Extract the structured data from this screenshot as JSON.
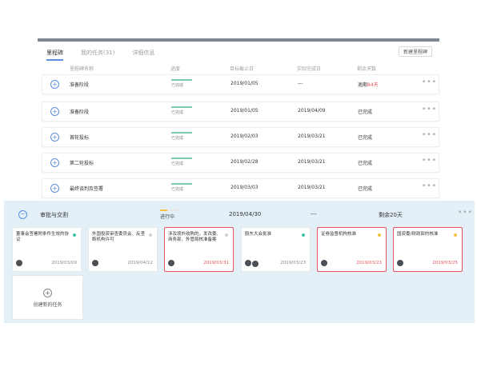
{
  "tabs": [
    {
      "label": "里程碑"
    },
    {
      "label": "我的任务(31)"
    },
    {
      "label": "详细信息"
    }
  ],
  "new_milestone_label": "新建里程碑",
  "header": {
    "name": "里程碑名称",
    "progress": "进度",
    "target": "目标截止日",
    "actual": "实际完成日",
    "remain": "剩余天数"
  },
  "rows": [
    {
      "name": "准备阶段",
      "progress": "已完成",
      "progress_fraction": 1,
      "target": "2019/01/05",
      "actual": "---",
      "remain_prefix": "逾期",
      "remain_late": "84天"
    },
    {
      "name": "准备阶段",
      "progress": "已完成",
      "progress_fraction": 1,
      "target": "2019/01/05",
      "actual": "2019/04/09",
      "remain_prefix": "已完成",
      "remain_late": ""
    },
    {
      "name": "首轮投标",
      "progress": "已完成",
      "progress_fraction": 1,
      "target": "2019/02/03",
      "actual": "2019/03/21",
      "remain_prefix": "已完成",
      "remain_late": ""
    },
    {
      "name": "第二轮投标",
      "progress": "已完成",
      "progress_fraction": 1,
      "target": "2019/02/28",
      "actual": "2019/03/21",
      "remain_prefix": "已完成",
      "remain_late": ""
    },
    {
      "name": "最终谈判及签署",
      "progress": "已完成",
      "progress_fraction": 1,
      "target": "2019/03/03",
      "actual": "2019/03/21",
      "remain_prefix": "已完成",
      "remain_late": ""
    }
  ],
  "section": {
    "name": "审批与交割",
    "progress": "进行中",
    "progress_fraction": 0.35,
    "target": "2019/04/30",
    "actual": "---",
    "remain": "剩余20天",
    "cards": [
      {
        "title": "董事会签署附条件生效的协议",
        "date": "2019/03/09",
        "status_color": "#3dbfa3",
        "late": false,
        "avatars": 1
      },
      {
        "title": "外国投资审查委员会、反垄断机构许可",
        "date": "2019/04/12",
        "status_color": "#cfd3d7",
        "late": false,
        "avatars": 1
      },
      {
        "title": "涉及境外收购的，发改委、商务部、外管局核准备案",
        "date": "2019/03/31",
        "status_color": "#cfd3d7",
        "late": true,
        "avatars": 1
      },
      {
        "title": "股东大会批准",
        "date": "2019/03/23",
        "status_color": "#3dbfa3",
        "late": false,
        "avatars": 2
      },
      {
        "title": "证券监督机构核准",
        "date": "2019/03/23",
        "status_color": "#f5c342",
        "late": true,
        "avatars": 1
      },
      {
        "title": "国资委/财政部的核准",
        "date": "2019/03/25",
        "status_color": "#f5c342",
        "late": true,
        "avatars": 1
      }
    ],
    "new_task_label": "创建新的任务"
  },
  "colors": {
    "accent": "#5a8fe0",
    "done": "#7ec8b5",
    "late": "#e8545c",
    "section_bg": "#e3f0f7"
  }
}
